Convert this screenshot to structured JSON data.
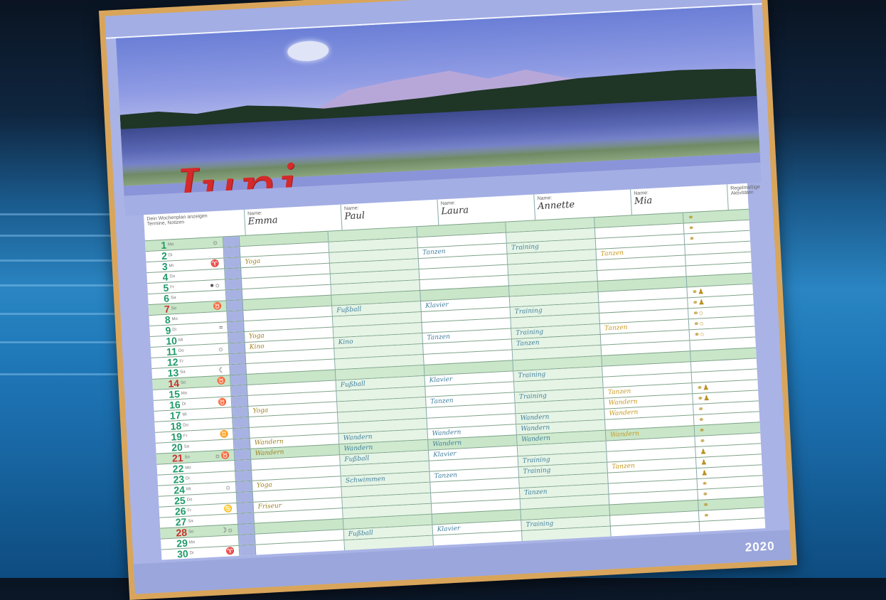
{
  "calendar": {
    "month": "Juni",
    "year": "2020",
    "header": {
      "legend": "Dein Wochenplan anzeigen",
      "legend2": "Termine, Notizen",
      "who_label": "Name:",
      "people": [
        "Emma",
        "Paul",
        "Laura",
        "Annette",
        "Mia"
      ],
      "extra": "Regelmäßige Aktivitäten"
    },
    "days": [
      {
        "n": "1",
        "w": "Mo",
        "sym": "☼",
        "weekend": true,
        "sun": false,
        "e": [
          "",
          "",
          "",
          "",
          ""
        ],
        "x": "⚭"
      },
      {
        "n": "2",
        "w": "Di",
        "sym": "",
        "weekend": false,
        "sun": false,
        "e": [
          "",
          "",
          "",
          "",
          ""
        ],
        "x": "⚭"
      },
      {
        "n": "3",
        "w": "Mi",
        "sym": "♈",
        "weekend": false,
        "sun": false,
        "e": [
          "Yoga",
          "",
          "Tanzen",
          "Training",
          ""
        ],
        "x": "⚭"
      },
      {
        "n": "4",
        "w": "Do",
        "sym": "",
        "weekend": false,
        "sun": false,
        "e": [
          "",
          "",
          "",
          "",
          "Tanzen"
        ],
        "x": ""
      },
      {
        "n": "5",
        "w": "Fr",
        "sym": "●☼",
        "weekend": false,
        "sun": false,
        "e": [
          "",
          "",
          "",
          "",
          ""
        ],
        "x": ""
      },
      {
        "n": "6",
        "w": "Sa",
        "sym": "",
        "weekend": false,
        "sun": false,
        "e": [
          "",
          "",
          "",
          "",
          ""
        ],
        "x": ""
      },
      {
        "n": "7",
        "w": "So",
        "sym": "♉",
        "weekend": true,
        "sun": true,
        "e": [
          "",
          "",
          "",
          "",
          ""
        ],
        "x": ""
      },
      {
        "n": "8",
        "w": "Mo",
        "sym": "",
        "weekend": false,
        "sun": false,
        "e": [
          "",
          "Fußball",
          "Klavier",
          "",
          ""
        ],
        "x": "⚭♟"
      },
      {
        "n": "9",
        "w": "Di",
        "sym": "≈",
        "weekend": false,
        "sun": false,
        "e": [
          "",
          "",
          "",
          "Training",
          ""
        ],
        "x": "⚭♟"
      },
      {
        "n": "10",
        "w": "Mi",
        "sym": "",
        "weekend": false,
        "sun": false,
        "e": [
          "Yoga",
          "",
          "",
          "",
          ""
        ],
        "x": "⚭○"
      },
      {
        "n": "11",
        "w": "Do",
        "sym": "☼",
        "weekend": false,
        "sun": false,
        "e": [
          "Kino",
          "Kino",
          "Tanzen",
          "Training",
          "Tanzen"
        ],
        "x": "⚭○"
      },
      {
        "n": "12",
        "w": "Fr",
        "sym": "",
        "weekend": false,
        "sun": false,
        "e": [
          "",
          "",
          "",
          "Tanzen",
          ""
        ],
        "x": "⚭○"
      },
      {
        "n": "13",
        "w": "Sa",
        "sym": "☾",
        "weekend": false,
        "sun": false,
        "e": [
          "",
          "",
          "",
          "",
          ""
        ],
        "x": ""
      },
      {
        "n": "14",
        "w": "So",
        "sym": "♉",
        "weekend": true,
        "sun": true,
        "e": [
          "",
          "",
          "",
          "",
          ""
        ],
        "x": ""
      },
      {
        "n": "15",
        "w": "Mo",
        "sym": "",
        "weekend": false,
        "sun": false,
        "e": [
          "",
          "Fußball",
          "Klavier",
          "Training",
          ""
        ],
        "x": ""
      },
      {
        "n": "16",
        "w": "Di",
        "sym": "♉",
        "weekend": false,
        "sun": false,
        "e": [
          "",
          "",
          "",
          "",
          ""
        ],
        "x": ""
      },
      {
        "n": "17",
        "w": "Mi",
        "sym": "",
        "weekend": false,
        "sun": false,
        "e": [
          "Yoga",
          "",
          "Tanzen",
          "Training",
          "Tanzen"
        ],
        "x": "⚭♟"
      },
      {
        "n": "18",
        "w": "Do",
        "sym": "",
        "weekend": false,
        "sun": false,
        "e": [
          "",
          "",
          "",
          "",
          "Wandern"
        ],
        "x": "⚭♟"
      },
      {
        "n": "19",
        "w": "Fr",
        "sym": "♊",
        "weekend": false,
        "sun": false,
        "e": [
          "",
          "",
          "",
          "Wandern",
          "Wandern"
        ],
        "x": "⚭"
      },
      {
        "n": "20",
        "w": "Sa",
        "sym": "",
        "weekend": false,
        "sun": false,
        "e": [
          "Wandern",
          "Wandern",
          "Wandern",
          "Wandern",
          ""
        ],
        "x": "⚭"
      },
      {
        "n": "21",
        "w": "So",
        "sym": "☼♉",
        "weekend": true,
        "sun": true,
        "e": [
          "Wandern",
          "Wandern",
          "Wandern",
          "Wandern",
          "Wandern"
        ],
        "x": "⚭"
      },
      {
        "n": "22",
        "w": "Mo",
        "sym": "",
        "weekend": false,
        "sun": false,
        "e": [
          "",
          "Fußball",
          "Klavier",
          "",
          ""
        ],
        "x": "⚭"
      },
      {
        "n": "23",
        "w": "Di",
        "sym": "",
        "weekend": false,
        "sun": false,
        "e": [
          "",
          "",
          "",
          "Training",
          ""
        ],
        "x": "♟"
      },
      {
        "n": "24",
        "w": "Mi",
        "sym": "☼",
        "weekend": false,
        "sun": false,
        "e": [
          "Yoga",
          "Schwimmen",
          "Tanzen",
          "Training",
          "Tanzen"
        ],
        "x": "♟"
      },
      {
        "n": "25",
        "w": "Do",
        "sym": "",
        "weekend": false,
        "sun": false,
        "e": [
          "",
          "",
          "",
          "",
          ""
        ],
        "x": "♟"
      },
      {
        "n": "26",
        "w": "Fr",
        "sym": "♋",
        "weekend": false,
        "sun": false,
        "e": [
          "Friseur",
          "",
          "",
          "Tanzen",
          ""
        ],
        "x": "⚭"
      },
      {
        "n": "27",
        "w": "Sa",
        "sym": "",
        "weekend": false,
        "sun": false,
        "e": [
          "",
          "",
          "",
          "",
          ""
        ],
        "x": "⚭"
      },
      {
        "n": "28",
        "w": "So",
        "sym": "☽☼",
        "weekend": true,
        "sun": true,
        "e": [
          "",
          "",
          "",
          "",
          ""
        ],
        "x": "⚭"
      },
      {
        "n": "29",
        "w": "Mo",
        "sym": "",
        "weekend": false,
        "sun": false,
        "e": [
          "",
          "Fußball",
          "Klavier",
          "Training",
          ""
        ],
        "x": "⚭"
      },
      {
        "n": "30",
        "w": "Di",
        "sym": "♈",
        "weekend": false,
        "sun": false,
        "e": [
          "",
          "",
          "",
          "",
          ""
        ],
        "x": ""
      }
    ]
  }
}
